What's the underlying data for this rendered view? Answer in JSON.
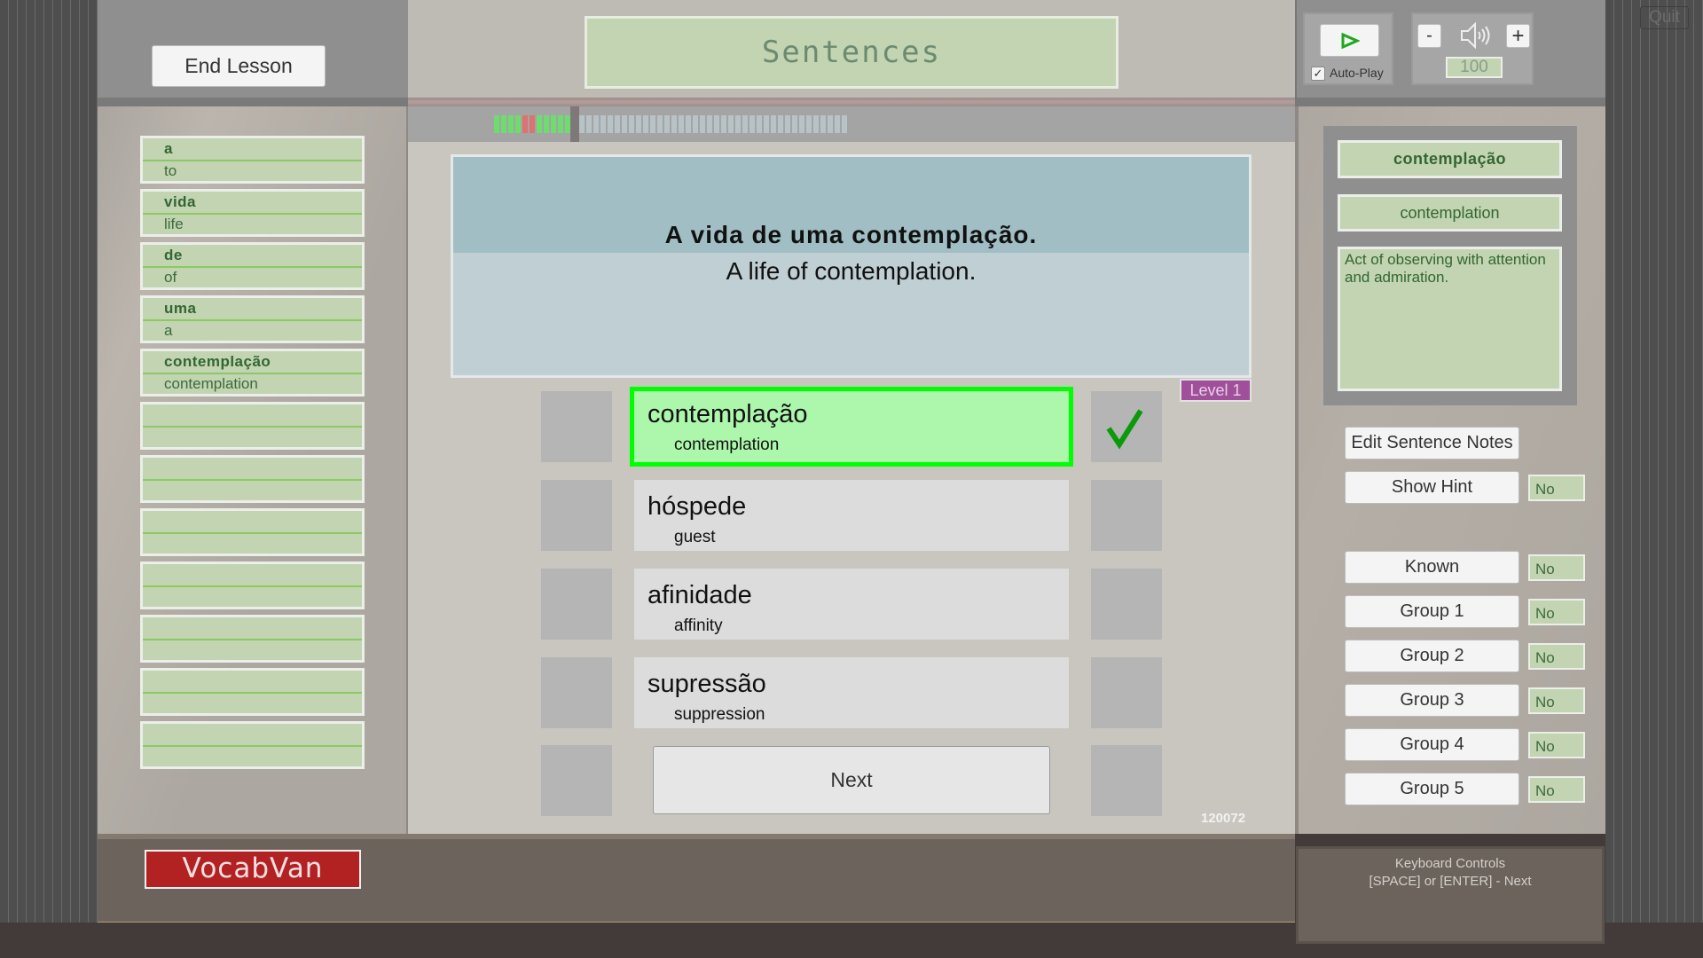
{
  "header": {
    "end_lesson": "End Lesson",
    "title": "Sentences",
    "quit": "Quit"
  },
  "audio": {
    "play_icon": "play-icon",
    "autoplay_label": "Auto-Play",
    "autoplay_checked": true,
    "volume_minus": "-",
    "volume_plus": "+",
    "volume": "100",
    "speaker_icon": "speaker-icon"
  },
  "progress": {
    "segments": [
      "correct",
      "correct",
      "correct",
      "correct",
      "wrong",
      "wrong",
      "correct",
      "correct",
      "correct",
      "correct",
      "correct",
      "correct",
      "pending",
      "pending",
      "pending",
      "pending",
      "pending",
      "pending",
      "pending",
      "pending",
      "pending",
      "pending",
      "pending",
      "pending",
      "pending",
      "pending",
      "pending",
      "pending",
      "pending",
      "pending",
      "pending",
      "pending",
      "pending",
      "pending",
      "pending",
      "pending",
      "pending",
      "pending",
      "pending",
      "pending",
      "pending",
      "pending",
      "pending",
      "pending",
      "pending",
      "pending",
      "pending",
      "pending",
      "pending",
      "pending"
    ],
    "current_index": 11,
    "colors": {
      "correct": "#6edc6e",
      "wrong": "#de7272",
      "pending": "#b7c3c6",
      "marker": "#807878"
    }
  },
  "words": [
    {
      "pt": "a",
      "en": "to"
    },
    {
      "pt": "vida",
      "en": "life"
    },
    {
      "pt": "de",
      "en": "of"
    },
    {
      "pt": "uma",
      "en": "a"
    },
    {
      "pt": "contemplação",
      "en": "contemplation"
    },
    {
      "pt": "",
      "en": ""
    },
    {
      "pt": "",
      "en": ""
    },
    {
      "pt": "",
      "en": ""
    },
    {
      "pt": "",
      "en": ""
    },
    {
      "pt": "",
      "en": ""
    },
    {
      "pt": "",
      "en": ""
    },
    {
      "pt": "",
      "en": ""
    }
  ],
  "sentence": {
    "pt": "A vida de uma contemplação.",
    "en": "A life of contemplation.",
    "level": "Level 1"
  },
  "choices": [
    {
      "pt": "contemplação",
      "en": "contemplation",
      "selected": true,
      "correct": true
    },
    {
      "pt": "hóspede",
      "en": "guest"
    },
    {
      "pt": "afinidade",
      "en": "affinity"
    },
    {
      "pt": "supressão",
      "en": "suppression"
    }
  ],
  "next_label": "Next",
  "id_code": "120072",
  "word_info": {
    "pt": "contemplação",
    "en": "contemplation",
    "note": "Act of observing with attention and admiration."
  },
  "side_buttons": {
    "edit_notes": "Edit Sentence Notes",
    "rows": [
      {
        "label": "Show Hint",
        "value": "No"
      },
      {
        "label": "Known",
        "value": "No"
      },
      {
        "label": "Group 1",
        "value": "No"
      },
      {
        "label": "Group 2",
        "value": "No"
      },
      {
        "label": "Group 3",
        "value": "No"
      },
      {
        "label": "Group 4",
        "value": "No"
      },
      {
        "label": "Group 5",
        "value": "No"
      }
    ]
  },
  "keyboard": {
    "title": "Keyboard Controls",
    "line1": "[SPACE] or [ENTER] - Next"
  },
  "logo": "VocabVan",
  "colors": {
    "accent_green": "#00ff00",
    "selected_bg": "#adf7ad",
    "level_badge": "#a0509a",
    "logo_red": "#b22222"
  }
}
